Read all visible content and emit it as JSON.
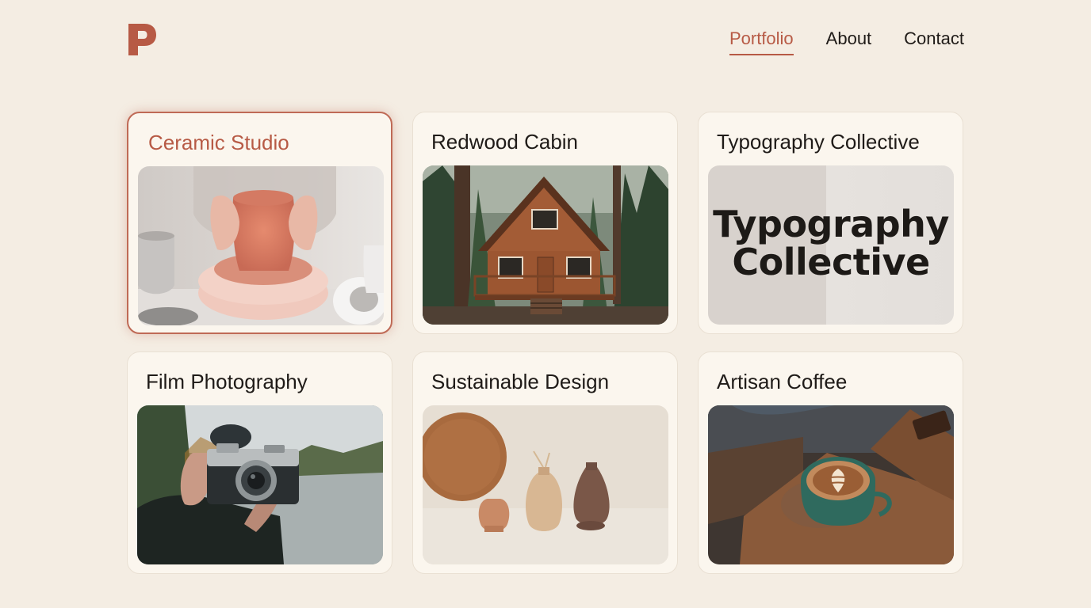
{
  "header": {
    "logo_letter": "P",
    "nav": [
      {
        "label": "Portfolio",
        "active": true
      },
      {
        "label": "About",
        "active": false
      },
      {
        "label": "Contact",
        "active": false
      }
    ]
  },
  "colors": {
    "accent": "#b75a45",
    "background": "#f4ede3",
    "card": "#fbf6ee"
  },
  "projects": [
    {
      "title": "Ceramic Studio",
      "image": "pottery-wheel-photo",
      "selected": true
    },
    {
      "title": "Redwood Cabin",
      "image": "forest-cabin-photo",
      "selected": false
    },
    {
      "title": "Typography Collective",
      "image": "typography-poster",
      "poster_text": "Typography Collective",
      "selected": false
    },
    {
      "title": "Film Photography",
      "image": "camera-lake-photo",
      "selected": false
    },
    {
      "title": "Sustainable Design",
      "image": "wooden-vases-photo",
      "selected": false
    },
    {
      "title": "Artisan Coffee",
      "image": "latte-cup-photo",
      "selected": false
    }
  ]
}
